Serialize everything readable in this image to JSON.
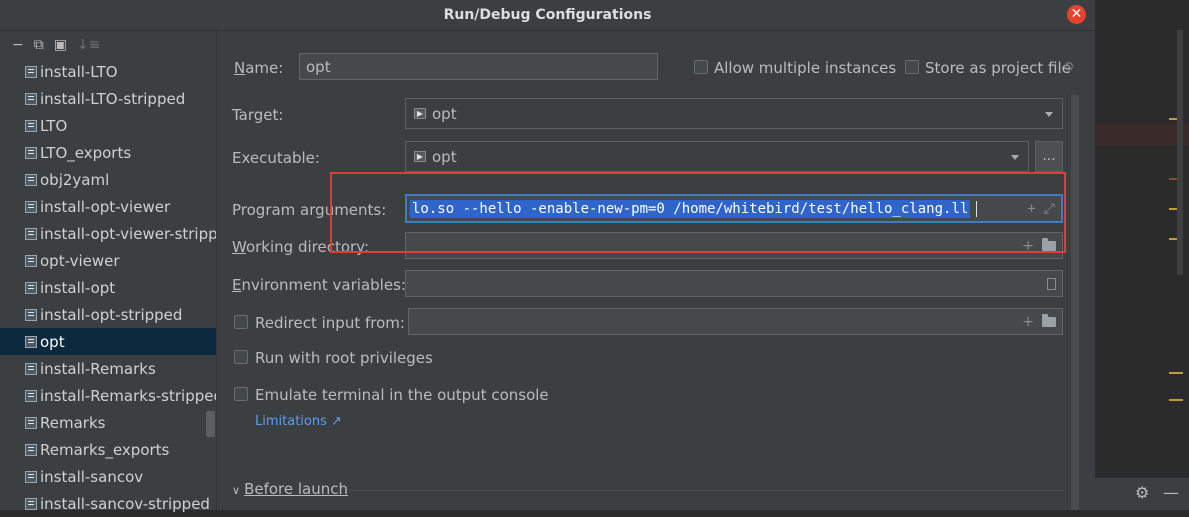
{
  "window": {
    "title": "Run/Debug Configurations",
    "close_glyph": "✕"
  },
  "sidebar": {
    "toolbar": {
      "remove": "−",
      "copy": "⧉",
      "new_folder": "▣",
      "sort": "↓≡"
    },
    "items": [
      {
        "label": "install-LTO"
      },
      {
        "label": "install-LTO-stripped"
      },
      {
        "label": "LTO"
      },
      {
        "label": "LTO_exports"
      },
      {
        "label": "obj2yaml"
      },
      {
        "label": "install-opt-viewer"
      },
      {
        "label": "install-opt-viewer-strippe"
      },
      {
        "label": "opt-viewer"
      },
      {
        "label": "install-opt"
      },
      {
        "label": "install-opt-stripped"
      },
      {
        "label": "opt"
      },
      {
        "label": "install-Remarks"
      },
      {
        "label": "install-Remarks-stripped"
      },
      {
        "label": "Remarks"
      },
      {
        "label": "Remarks_exports"
      },
      {
        "label": "install-sancov"
      },
      {
        "label": "install-sancov-stripped"
      }
    ],
    "selected_index": 10
  },
  "form": {
    "name_label": "Name:",
    "name_value": "opt",
    "allow_multiple_label": "Allow multiple instances",
    "store_project_label": "Store as project file",
    "target_label": "Target:",
    "target_value": "opt",
    "executable_label": "Executable:",
    "executable_value": "opt",
    "ellipsis": "...",
    "program_args_label": "Program arguments:",
    "program_args_value": "lo.so --hello -enable-new-pm=0 /home/whitebird/test/hello_clang.ll",
    "working_dir_label": "Working directory:",
    "working_dir_value": "",
    "env_vars_label": "Environment variables:",
    "env_vars_value": "",
    "redirect_input_label": "Redirect input from:",
    "redirect_input_value": "",
    "run_root_label": "Run with root privileges",
    "emulate_terminal_label": "Emulate terminal in the output console",
    "limitations_link": "Limitations ↗",
    "before_launch_label": "Before launch",
    "plus_glyph": "+",
    "expand_glyph": "⤢"
  },
  "colors": {
    "dialog_bg": "#3c3f41",
    "selection": "#0d293e",
    "text_selection": "#2f65ca",
    "highlight_box": "#e03c3c",
    "link": "#589df6"
  }
}
